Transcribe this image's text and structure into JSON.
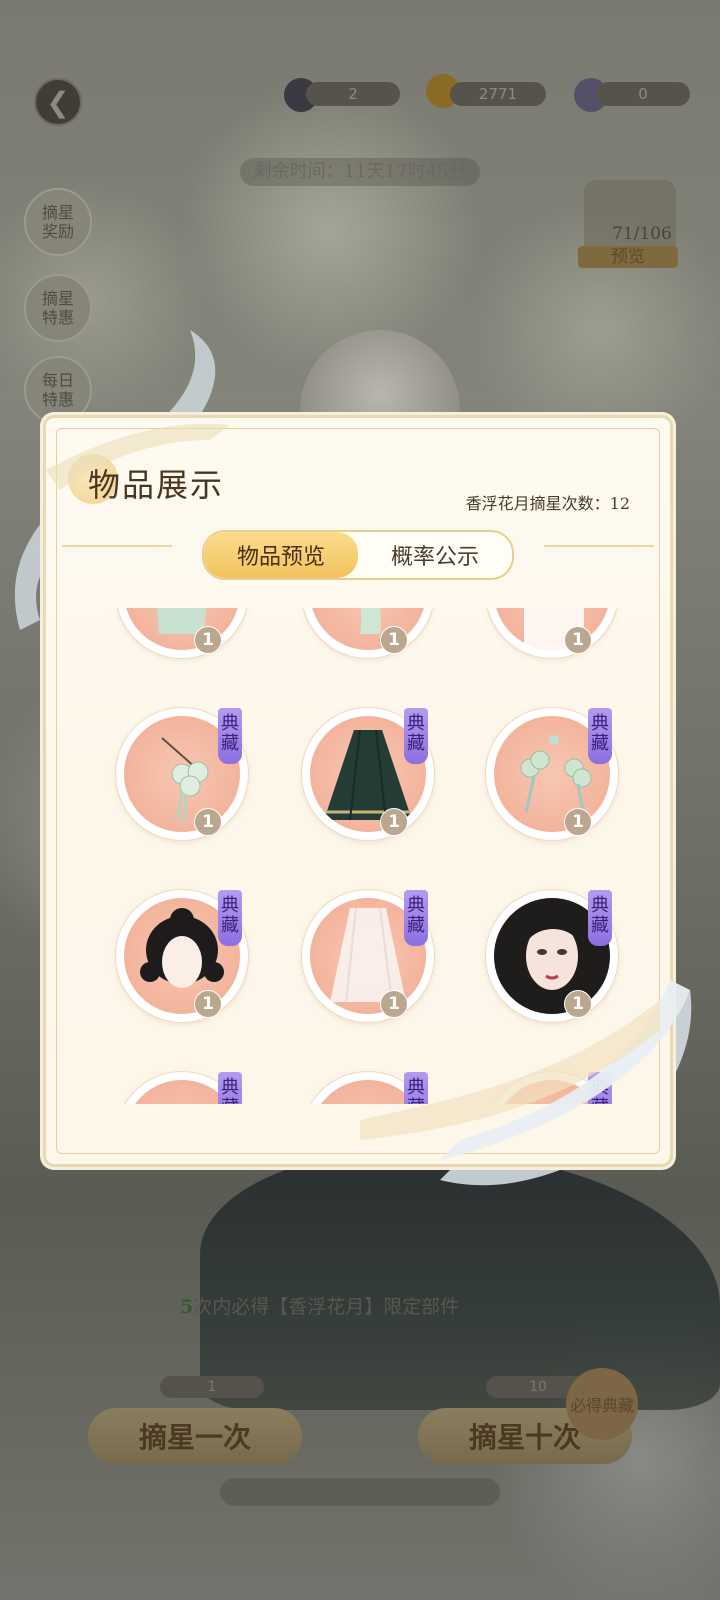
{
  "header": {
    "currencies": [
      {
        "icon": "star-icon",
        "value": "2"
      },
      {
        "icon": "gold-coin-icon",
        "value": "2771"
      },
      {
        "icon": "gem-icon",
        "value": "0"
      }
    ],
    "timer": "剩余时间：11天17时45分"
  },
  "side_menu": [
    {
      "label": "摘星\n奖励"
    },
    {
      "label": "摘星\n特惠"
    },
    {
      "label": "每日\n特惠"
    }
  ],
  "preview": {
    "count": "71/106",
    "label": "预览"
  },
  "bottom": {
    "guarantee_num": "5",
    "guarantee_text": "次内必得【香浮花月】限定部件",
    "single_cost": "1",
    "ten_cost": "10",
    "draw_once": "摘星一次",
    "draw_ten": "摘星十次",
    "seal": "必得典藏"
  },
  "dialog": {
    "title": "物品展示",
    "draw_count_label": "香浮花月摘星次数：",
    "draw_count": "12",
    "tabs": [
      {
        "label": "物品预览",
        "active": true
      },
      {
        "label": "概率公示",
        "active": false
      }
    ],
    "items": [
      {
        "name": "green-outfit",
        "quantity": "1",
        "tag": ""
      },
      {
        "name": "green-sleeve",
        "quantity": "1",
        "tag": ""
      },
      {
        "name": "jade-chain",
        "quantity": "1",
        "tag": ""
      },
      {
        "name": "flower-hairpin",
        "quantity": "1",
        "tag": "典藏"
      },
      {
        "name": "dark-green-skirt",
        "quantity": "1",
        "tag": "典藏"
      },
      {
        "name": "floral-hair-ornament",
        "quantity": "1",
        "tag": "典藏"
      },
      {
        "name": "black-hairstyle",
        "quantity": "1",
        "tag": "典藏"
      },
      {
        "name": "white-veil",
        "quantity": "1",
        "tag": "典藏"
      },
      {
        "name": "makeup-face",
        "quantity": "1",
        "tag": "典藏"
      },
      {
        "name": "item-10",
        "quantity": "",
        "tag": "典藏"
      },
      {
        "name": "item-11",
        "quantity": "",
        "tag": "典藏"
      },
      {
        "name": "item-12",
        "quantity": "",
        "tag": "典藏"
      }
    ]
  },
  "colors": {
    "tab_active": "#f3c25f",
    "collection_tag": "#8c6fe0",
    "panel_bg": "#fdf7ea"
  }
}
